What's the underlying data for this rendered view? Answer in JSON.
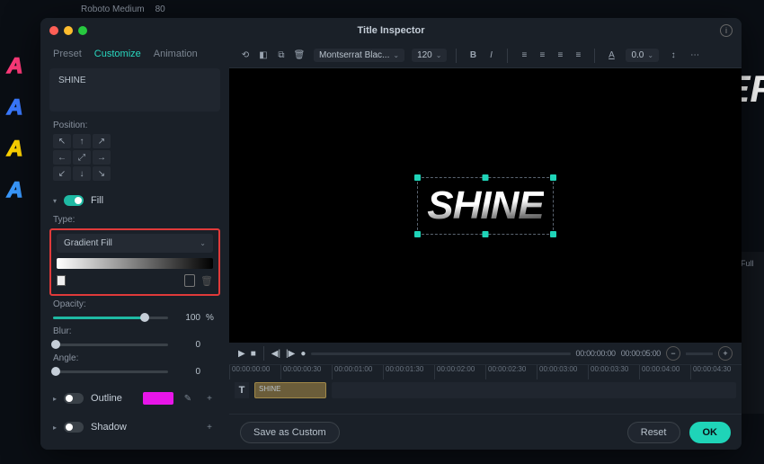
{
  "bg": {
    "font_name": "Roboto Medium",
    "font_size": "80",
    "right_text": "EF",
    "full_label": "Full"
  },
  "window": {
    "title": "Title Inspector"
  },
  "tabs": {
    "preset": "Preset",
    "customize": "Customize",
    "animation": "Animation"
  },
  "textcard": {
    "value": "SHINE"
  },
  "position": {
    "label": "Position:"
  },
  "fill": {
    "label": "Fill",
    "type_label": "Type:",
    "type_value": "Gradient Fill",
    "opacity_label": "Opacity:",
    "opacity_value": "100",
    "opacity_unit": "%",
    "blur_label": "Blur:",
    "blur_value": "0",
    "angle_label": "Angle:",
    "angle_value": "0"
  },
  "outline": {
    "label": "Outline",
    "color": "#e815e8"
  },
  "shadow": {
    "label": "Shadow"
  },
  "toolbar": {
    "font_name": "Montserrat Blac...",
    "font_size": "120",
    "spacing": "0.0"
  },
  "canvas": {
    "text": "SHINE"
  },
  "transport": {
    "tc1": "00:00:00:00",
    "tc2": "00:00:05:00"
  },
  "ruler": [
    "00:00:00:00",
    "00:00:00:30",
    "00:00:01:00",
    "00:00:01:30",
    "00:00:02:00",
    "00:00:02:30",
    "00:00:03:00",
    "00:00:03:30",
    "00:00:04:00",
    "00:00:04:30"
  ],
  "clip": {
    "label": "SHINE"
  },
  "footer": {
    "save": "Save as Custom",
    "reset": "Reset",
    "ok": "OK"
  }
}
